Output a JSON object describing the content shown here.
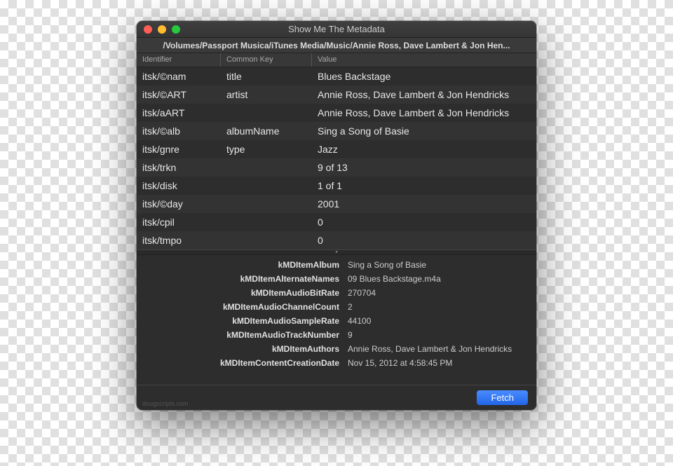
{
  "window": {
    "title": "Show Me The Metadata",
    "path": "/Volumes/Passport Musica/iTunes Media/Music/Annie Ross, Dave Lambert & Jon Hen..."
  },
  "table": {
    "headers": {
      "identifier": "Identifier",
      "commonKey": "Common Key",
      "value": "Value"
    },
    "rows": [
      {
        "id": "itsk/©nam",
        "key": "title",
        "val": "Blues Backstage"
      },
      {
        "id": "itsk/©ART",
        "key": "artist",
        "val": "Annie Ross, Dave Lambert & Jon Hendricks"
      },
      {
        "id": "itsk/aART",
        "key": "",
        "val": "Annie Ross, Dave Lambert & Jon Hendricks"
      },
      {
        "id": "itsk/©alb",
        "key": "albumName",
        "val": "Sing a Song of Basie"
      },
      {
        "id": "itsk/gnre",
        "key": "type",
        "val": "Jazz"
      },
      {
        "id": "itsk/trkn",
        "key": "",
        "val": "9 of 13"
      },
      {
        "id": "itsk/disk",
        "key": "",
        "val": "1 of 1"
      },
      {
        "id": "itsk/©day",
        "key": "",
        "val": "2001"
      },
      {
        "id": "itsk/cpil",
        "key": "",
        "val": "0"
      },
      {
        "id": "itsk/tmpo",
        "key": "",
        "val": "0"
      }
    ]
  },
  "details": [
    {
      "k": "kMDItemAlbum",
      "v": "Sing a Song of Basie"
    },
    {
      "k": "kMDItemAlternateNames",
      "v": "09 Blues Backstage.m4a"
    },
    {
      "k": "kMDItemAudioBitRate",
      "v": "270704"
    },
    {
      "k": "kMDItemAudioChannelCount",
      "v": "2"
    },
    {
      "k": "kMDItemAudioSampleRate",
      "v": "44100"
    },
    {
      "k": "kMDItemAudioTrackNumber",
      "v": "9"
    },
    {
      "k": "kMDItemAuthors",
      "v": "Annie Ross, Dave Lambert & Jon Hendricks"
    },
    {
      "k": "kMDItemContentCreationDate",
      "v": "Nov 15, 2012 at 4:58:45 PM"
    }
  ],
  "footer": {
    "fetch": "Fetch",
    "credit": "dougscripts.com"
  }
}
